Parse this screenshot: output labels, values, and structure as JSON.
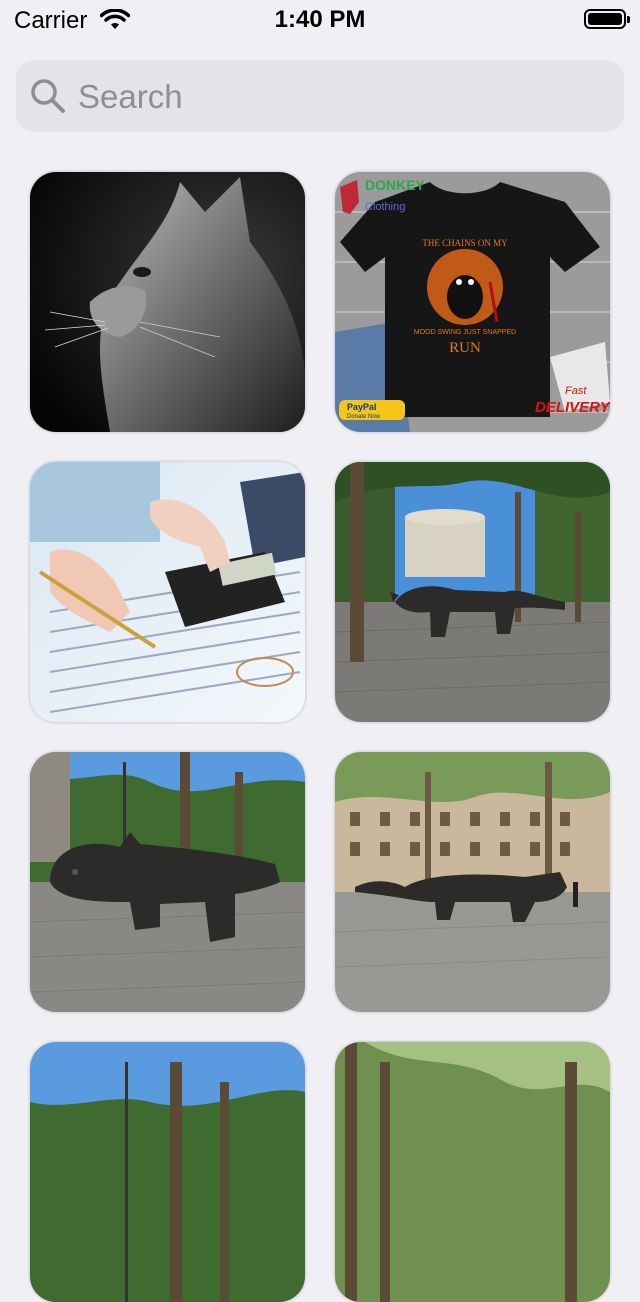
{
  "status_bar": {
    "carrier": "Carrier",
    "time": "1:40 PM",
    "wifi_icon": "wifi-icon",
    "battery_icon": "battery-icon"
  },
  "search": {
    "placeholder": "Search",
    "value": "",
    "icon": "search-icon"
  },
  "grid": {
    "items": [
      {
        "name": "photo-gray-cat"
      },
      {
        "name": "photo-tshirt-product"
      },
      {
        "name": "photo-calculator-hands"
      },
      {
        "name": "photo-cat-statue-1"
      },
      {
        "name": "photo-cat-statue-2"
      },
      {
        "name": "photo-cat-statue-3"
      },
      {
        "name": "photo-street-trees-1"
      },
      {
        "name": "photo-street-trees-2"
      }
    ],
    "tshirt": {
      "brand": "DONKEY",
      "brand_sub": "Clothing",
      "line1": "THE CHAINS ON MY",
      "line2": "MOOD SWING JUST SNAPPED",
      "line3": "RUN",
      "paypal": "PayPal",
      "paypal_sub": "Donate Now",
      "delivery1": "Fast",
      "delivery2": "DELIVERY"
    }
  }
}
